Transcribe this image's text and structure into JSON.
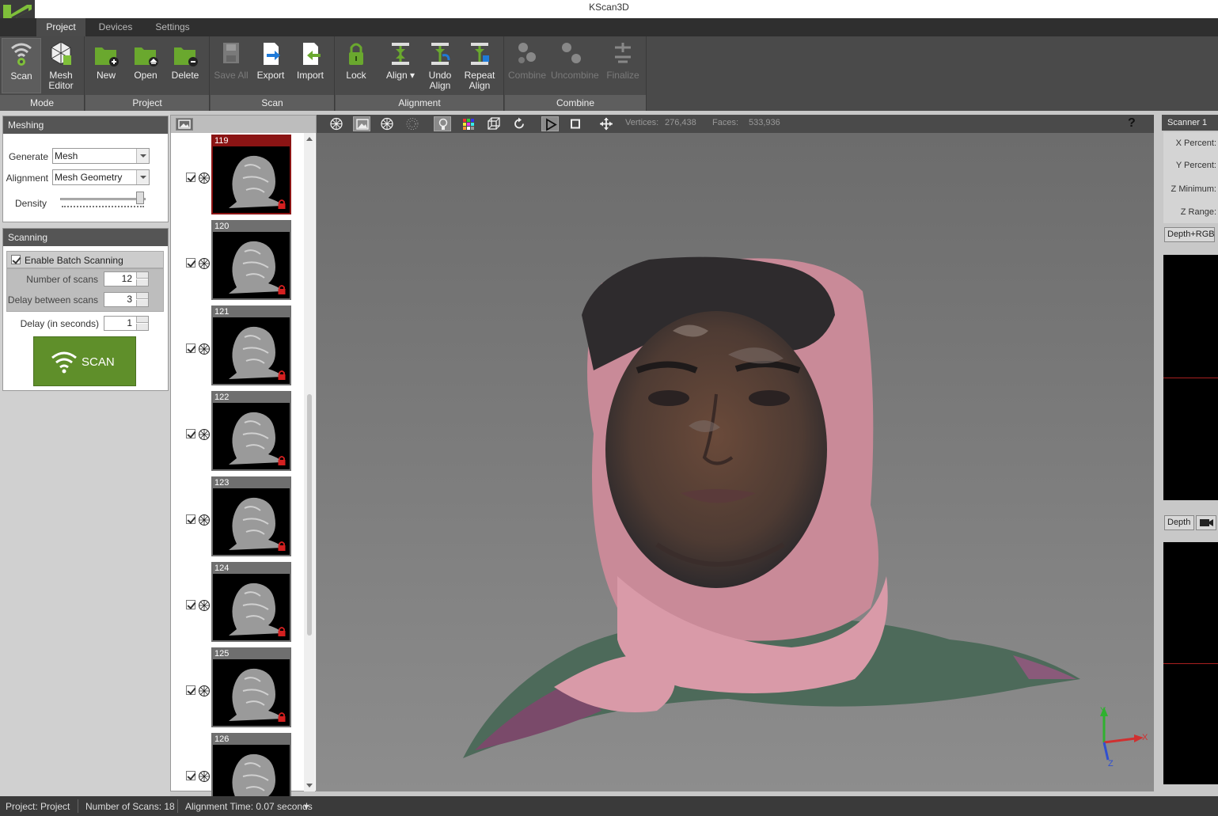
{
  "window": {
    "title": "KScan3D"
  },
  "tabs": [
    {
      "label": "Project",
      "active": true
    },
    {
      "label": "Devices",
      "active": false
    },
    {
      "label": "Settings",
      "active": false
    }
  ],
  "ribbon": {
    "mode": {
      "label": "Mode",
      "scan": "Scan",
      "mesh_editor_1": "Mesh",
      "mesh_editor_2": "Editor"
    },
    "project": {
      "label": "Project",
      "new": "New",
      "open": "Open",
      "delete": "Delete"
    },
    "scan": {
      "label": "Scan",
      "save_all": "Save All",
      "export": "Export",
      "import": "Import"
    },
    "alignment": {
      "label": "Alignment",
      "lock": "Lock",
      "align": "Align",
      "undo_align_1": "Undo",
      "undo_align_2": "Align",
      "repeat_align_1": "Repeat",
      "repeat_align_2": "Align"
    },
    "combine": {
      "label": "Combine",
      "combine": "Combine",
      "uncombine": "Uncombine",
      "finalize": "Finalize"
    }
  },
  "meshing": {
    "title": "Meshing",
    "generate_label": "Generate",
    "generate_value": "Mesh",
    "alignment_label": "Alignment",
    "alignment_value": "Mesh Geometry",
    "density_label": "Density",
    "density_level": 1.0
  },
  "scanning": {
    "title": "Scanning",
    "batch_label": "Enable Batch Scanning",
    "batch_checked": true,
    "num_scans_label": "Number of scans",
    "num_scans_value": "12",
    "delay_between_label": "Delay between scans",
    "delay_between_value": "3",
    "delay_label": "Delay (in seconds)",
    "delay_value": "1",
    "scan_button": "SCAN"
  },
  "scans": [
    {
      "number": "119",
      "selected": true,
      "checked": true,
      "locked": true
    },
    {
      "number": "120",
      "selected": false,
      "checked": true,
      "locked": true
    },
    {
      "number": "121",
      "selected": false,
      "checked": true,
      "locked": true
    },
    {
      "number": "122",
      "selected": false,
      "checked": true,
      "locked": true
    },
    {
      "number": "123",
      "selected": false,
      "checked": true,
      "locked": true
    },
    {
      "number": "124",
      "selected": false,
      "checked": true,
      "locked": true
    },
    {
      "number": "125",
      "selected": false,
      "checked": true,
      "locked": true
    },
    {
      "number": "126",
      "selected": false,
      "checked": true,
      "locked": false
    }
  ],
  "viewer": {
    "vertices_label": "Vertices:",
    "vertices_value": "276,438",
    "faces_label": "Faces:",
    "faces_value": "533,936",
    "help": "?",
    "axis_x": "X",
    "axis_y": "Y",
    "axis_z": "Z"
  },
  "scanner": {
    "title": "Scanner 1",
    "x_percent": "X Percent:",
    "y_percent": "Y Percent:",
    "z_minimum": "Z Minimum:",
    "z_range": "Z Range:",
    "depth_rgb": "Depth+RGB",
    "depth": "Depth"
  },
  "status": {
    "project": "Project:  Project",
    "num_scans": "Number of Scans:  18",
    "align_time": "Alignment Time:  0.07 seconds"
  },
  "colors": {
    "scan_button": "#5f8f2a",
    "selected_thumb": "#8b1414",
    "ribbon": "#4a4a4a",
    "lock_red": "#d42020"
  }
}
